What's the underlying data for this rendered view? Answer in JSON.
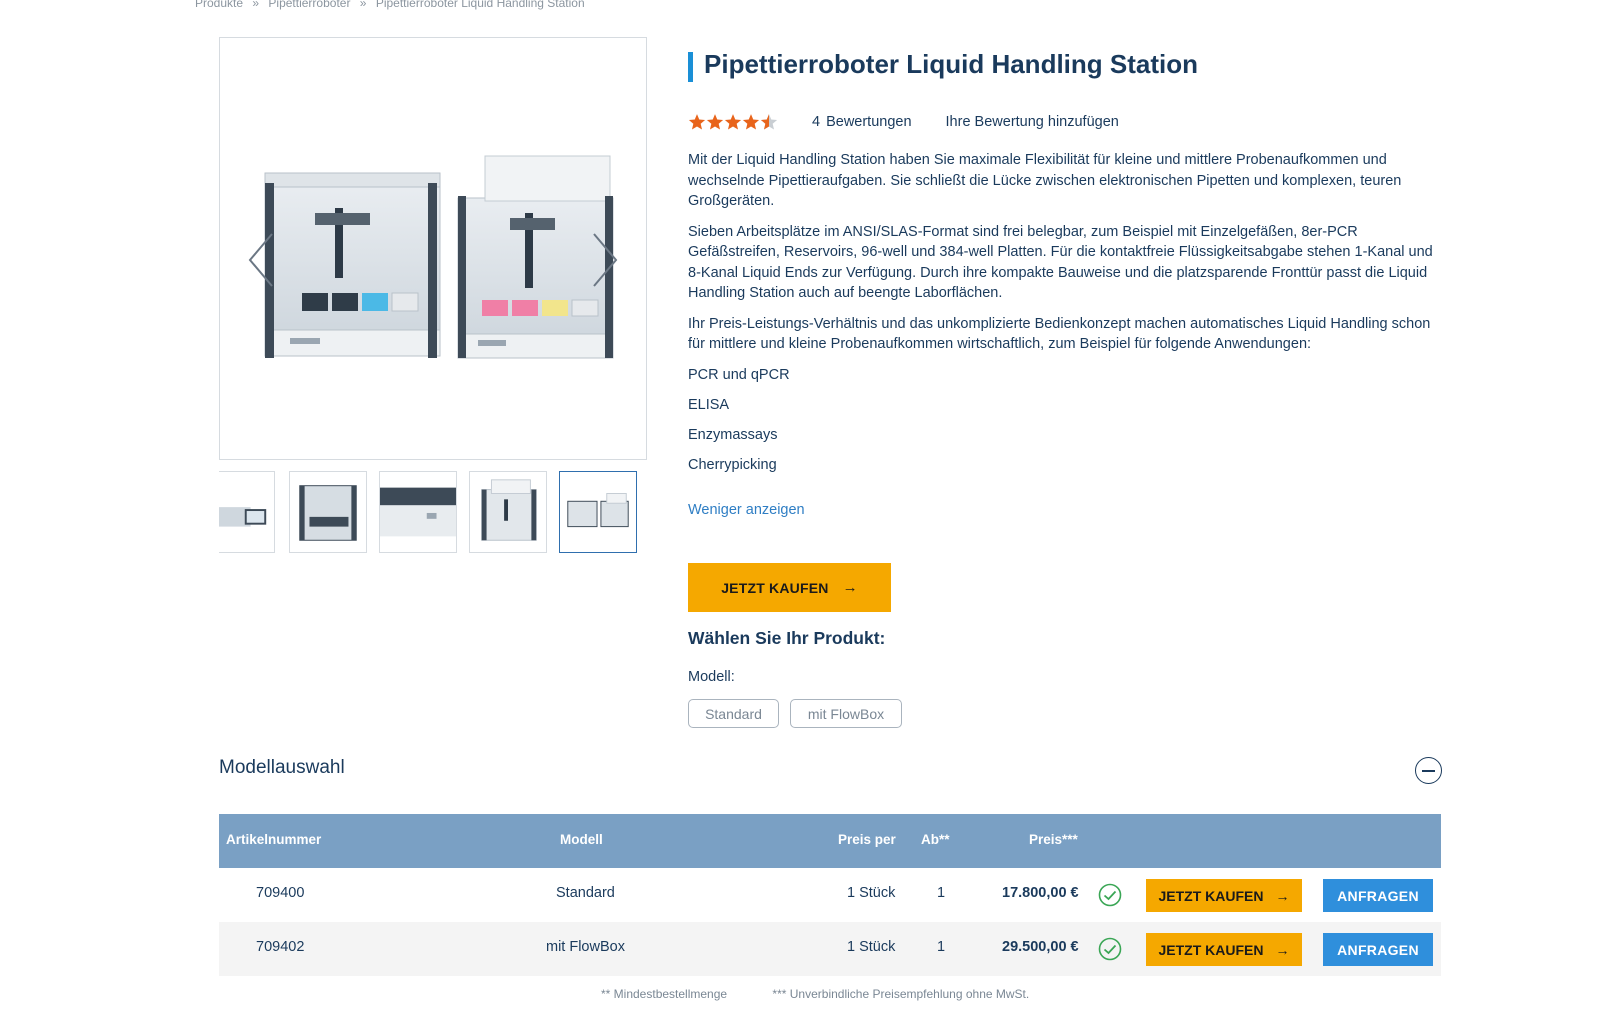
{
  "breadcrumb": [
    "Produkte",
    "»",
    "Pipettierroboter",
    "»",
    "Pipettierroboter Liquid Handling Station"
  ],
  "product": {
    "title": "Pipettierroboter Liquid Handling Station",
    "rating": {
      "stars": 4.5,
      "max": 5,
      "count": "4",
      "reviews_label": "Bewertungen",
      "add_review": "Ihre Bewertung hinzufügen"
    },
    "description": [
      "Mit der Liquid Handling Station haben Sie maximale Flexibilität für kleine und mittlere Probenaufkommen und wechselnde Pipettieraufgaben. Sie schließt die Lücke zwischen elektronischen Pipetten und komplexen, teuren Großgeräten.",
      "Sieben Arbeitsplätze im ANSI/SLAS-Format sind frei belegbar, zum Beispiel mit Einzelgefäßen, 8er-PCR Gefäßstreifen, Reservoirs, 96-well und 384-well Platten. Für die kontaktfreie Flüssigkeitsabgabe stehen 1-Kanal und 8-Kanal Liquid Ends zur Verfügung. Durch ihre kompakte Bauweise und die platzsparende Fronttür passt die Liquid Handling Station auch auf beengte Laborflächen.",
      "Ihr Preis-Leistungs-Verhältnis und das unkomplizierte Bedienkonzept machen automatisches Liquid Handling schon für mittlere und kleine Probenaufkommen wirtschaftlich, zum Beispiel für folgende Anwendungen:"
    ],
    "applications": [
      "PCR und qPCR",
      "ELISA",
      "Enzymassays",
      "Cherrypicking"
    ],
    "less_link": "Weniger anzeigen",
    "buy_label": "JETZT KAUFEN",
    "choose_title": "Wählen Sie Ihr Produkt:",
    "model_label": "Modell:",
    "model_options": [
      "Standard",
      "mit FlowBox"
    ]
  },
  "model_selection": {
    "title": "Modellauswahl",
    "headers": {
      "article": "Artikelnummer",
      "model": "Modell",
      "price_per": "Preis per",
      "min": "Ab**",
      "price": "Preis***"
    },
    "rows": [
      {
        "article": "709400",
        "model": "Standard",
        "price_per": "1 Stück",
        "min": "1",
        "price": "17.800,00 €",
        "buy": "JETZT KAUFEN",
        "ask": "ANFRAGEN"
      },
      {
        "article": "709402",
        "model": "mit FlowBox",
        "price_per": "1 Stück",
        "min": "1",
        "price": "29.500,00 €",
        "buy": "JETZT KAUFEN",
        "ask": "ANFRAGEN"
      }
    ],
    "footnote_min": "** Mindestbestellmenge",
    "footnote_price": "*** Unverbindliche Preisempfehlung ohne MwSt."
  },
  "colors": {
    "accent_yellow": "#f5a800",
    "accent_blue": "#2f8fdc",
    "header_blue": "#7aa0c4",
    "text_navy": "#1a3a5c",
    "star_orange": "#e8641b"
  }
}
